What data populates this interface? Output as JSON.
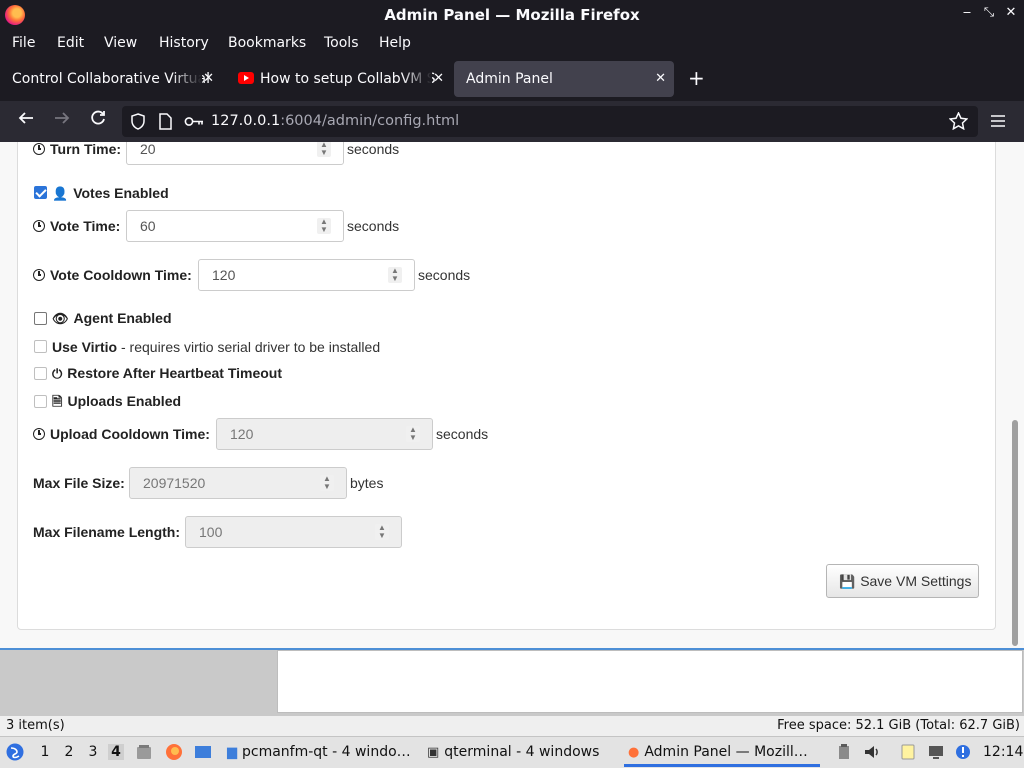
{
  "window": {
    "title": "Admin Panel — Mozilla Firefox",
    "min_glyph": "‒",
    "max_glyph": "⤡",
    "close_glyph": "✕"
  },
  "menubar": {
    "items": [
      {
        "label": "File"
      },
      {
        "label": "Edit"
      },
      {
        "label": "View"
      },
      {
        "label": "History"
      },
      {
        "label": "Bookmarks"
      },
      {
        "label": "Tools"
      },
      {
        "label": "Help"
      }
    ]
  },
  "tabs": [
    {
      "label": "Control Collaborative Virtual",
      "active": false,
      "icon": "none"
    },
    {
      "label": "How to setup CollabVM S",
      "active": false,
      "icon": "youtube-icon"
    },
    {
      "label": "Admin Panel",
      "active": true,
      "icon": "none"
    }
  ],
  "tab_close_glyph": "✕",
  "new_tab_glyph": "+",
  "nav": {
    "url_host": "127.0.0.1",
    "url_rest": ":6004/admin/config.html"
  },
  "form": {
    "turn_time": {
      "label": "Turn Time:",
      "value": "20",
      "unit": "seconds"
    },
    "votes_enabled": {
      "label": "Votes Enabled",
      "checked": true,
      "icon": "user-icon"
    },
    "vote_time": {
      "label": "Vote Time:",
      "value": "60",
      "unit": "seconds"
    },
    "vote_cooldown": {
      "label": "Vote Cooldown Time:",
      "value": "120",
      "unit": "seconds"
    },
    "agent_enabled": {
      "label": "Agent Enabled",
      "checked": false,
      "icon": "eye-icon"
    },
    "use_virtio": {
      "label": "Use Virtio",
      "note": " - requires virtio serial driver to be installed",
      "checked": false
    },
    "restore_heartbeat": {
      "label": "Restore After Heartbeat Timeout",
      "checked": false,
      "icon": "power-icon"
    },
    "uploads_enabled": {
      "label": "Uploads Enabled",
      "checked": false,
      "icon": "file-icon"
    },
    "upload_cooldown": {
      "label": "Upload Cooldown Time:",
      "value": "120",
      "unit": "seconds"
    },
    "max_file_size": {
      "label": "Max File Size:",
      "value": "20971520",
      "unit": "bytes"
    },
    "max_filename_length": {
      "label": "Max Filename Length:",
      "value": "100"
    },
    "save_button": "Save VM Settings"
  },
  "filemanager": {
    "item_count": "3 item(s)",
    "free_space": "Free space: 52.1 GiB (Total: 62.7 GiB)"
  },
  "taskbar": {
    "desktops": [
      "1",
      "2",
      "3",
      "4"
    ],
    "current_desktop": "4",
    "tasks": [
      {
        "label": "pcmanfm-qt - 4 windo…",
        "icon": "folder-icon",
        "active": false
      },
      {
        "label": "qterminal - 4 windows",
        "icon": "terminal-icon",
        "active": false
      },
      {
        "label": "Admin Panel — Mozill…",
        "icon": "firefox-icon",
        "active": true
      }
    ],
    "clock": "12:14"
  },
  "colors": {
    "accent": "#2b74d9",
    "titlebar": "#1c1b22",
    "navbar": "#2b2a33"
  }
}
